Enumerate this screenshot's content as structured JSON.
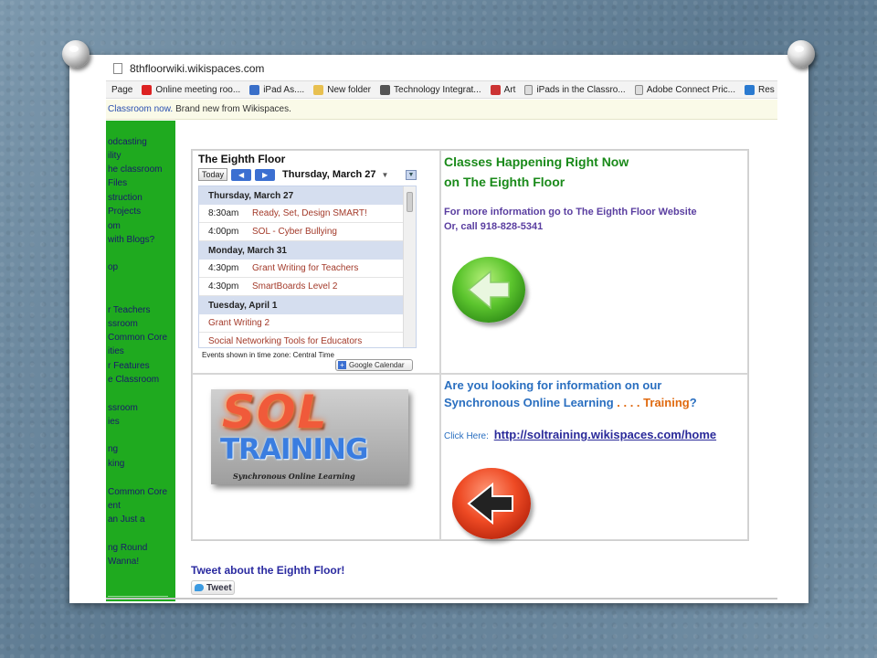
{
  "browser": {
    "url": "8thfloorwiki.wikispaces.com",
    "bookmarks": [
      {
        "label": "Page",
        "icon": "none"
      },
      {
        "label": "Online meeting roo...",
        "icon": "adobe-icon"
      },
      {
        "label": "iPad As....",
        "icon": "ipad-icon"
      },
      {
        "label": "New folder",
        "icon": "folder-icon"
      },
      {
        "label": "Technology Integrat...",
        "icon": "gear-icon"
      },
      {
        "label": "Art",
        "icon": "art-icon"
      },
      {
        "label": "iPads in the Classro...",
        "icon": "page-icon"
      },
      {
        "label": "Adobe Connect Pric...",
        "icon": "page-icon"
      },
      {
        "label": "Res",
        "icon": "web-icon"
      }
    ]
  },
  "notice": {
    "link": "Classroom now.",
    "text": "Brand new from Wikispaces."
  },
  "sidebar": {
    "links": [
      "odcasting",
      "ility",
      "he classroom",
      "Files",
      "struction",
      "Projects",
      "om",
      "with Blogs?",
      "op",
      "r Teachers",
      "ssroom",
      "Common Core",
      "ities",
      "r Features",
      "e Classroom",
      "ssroom",
      "ies",
      "ng",
      "king",
      "Common Core",
      "ent",
      "an Just a",
      "ng Round",
      "Wanna!"
    ]
  },
  "calendar": {
    "title": "The Eighth Floor",
    "today_label": "Today",
    "current_date": "Thursday, March 27",
    "rows": [
      {
        "type": "day",
        "label": "Thursday, March 27"
      },
      {
        "type": "event",
        "time": "8:30am",
        "title": "Ready, Set, Design SMART!"
      },
      {
        "type": "event",
        "time": "4:00pm",
        "title": "SOL - Cyber Bullying"
      },
      {
        "type": "day",
        "label": "Monday, March 31"
      },
      {
        "type": "event",
        "time": "4:30pm",
        "title": "Grant Writing for Teachers"
      },
      {
        "type": "event",
        "time": "4:30pm",
        "title": "SmartBoards Level 2"
      },
      {
        "type": "day",
        "label": "Tuesday, April 1"
      },
      {
        "type": "event",
        "time": "",
        "title": "Grant Writing 2"
      },
      {
        "type": "event",
        "time": "",
        "title": "Social Networking Tools for Educators"
      }
    ],
    "timezone_note": "Events shown in time zone: Central Time",
    "google_button": "Google Calendar"
  },
  "classes": {
    "heading_line1": "Classes Happening Right Now",
    "heading_line2": "on The Eighth Floor",
    "info_line1": "For more information go to The Eighth Floor Website",
    "info_line2": "Or, call 918-828-5341"
  },
  "sol": {
    "logo_word": "SOL",
    "logo_training": "TRAINING",
    "logo_sub": "Synchronous Online Learning",
    "question_line1": "Are you looking for information on our",
    "question_line2_a": "Synchronous Online Learning",
    "question_line2_dots": " . . . . ",
    "question_line2_b": "Training",
    "question_line2_q": "?",
    "click_label": "Click Here:",
    "click_url": "http://soltraining.wikispaces.com/home"
  },
  "tweet": {
    "heading": "Tweet about the Eighth Floor!",
    "button": "Tweet"
  }
}
